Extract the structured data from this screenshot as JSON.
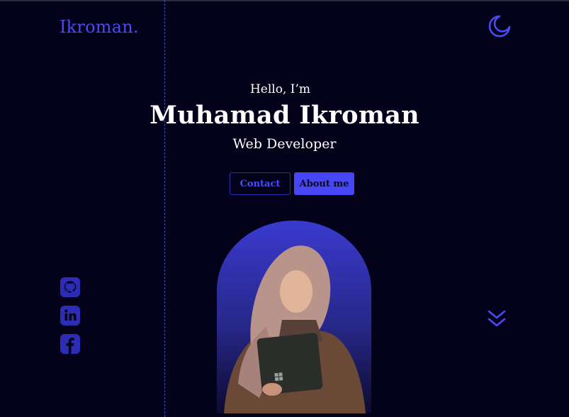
{
  "brand": {
    "logo": "Ikroman."
  },
  "header": {
    "theme_toggle_icon": "moon-icon"
  },
  "hero": {
    "greeting": "Hello, I’m",
    "name": "Muhamad Ikroman",
    "role": "Web Developer",
    "contact_label": "Contact",
    "about_label": "About me"
  },
  "social": {
    "icons": [
      "github-icon",
      "linkedin-icon",
      "facebook-icon"
    ]
  },
  "scroll": {
    "icon": "chevrons-down-icon"
  },
  "colors": {
    "background": "#03021a",
    "accent": "#4646f6",
    "guide_line": "#3b67c9"
  }
}
